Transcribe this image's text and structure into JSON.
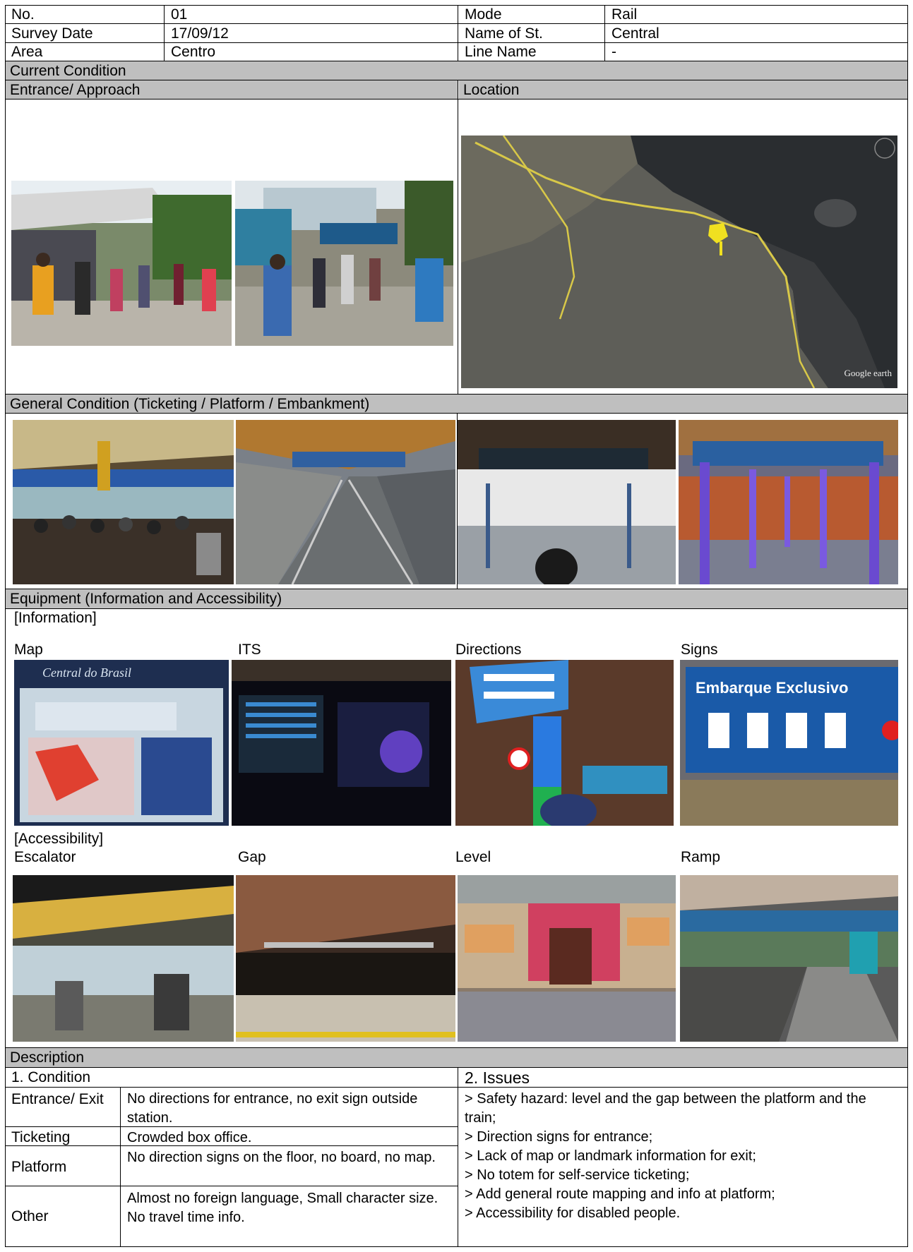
{
  "header": {
    "no_label": "No.",
    "no_value": "01",
    "mode_label": "Mode",
    "mode_value": "Rail",
    "date_label": "Survey Date",
    "date_value": "17/09/12",
    "station_label": "Name of St.",
    "station_value": "Central",
    "area_label": "Area",
    "area_value": "Centro",
    "line_label": "Line Name",
    "line_value": "-"
  },
  "sections": {
    "current_condition": "Current Condition",
    "entrance_approach": "Entrance/ Approach",
    "location": "Location",
    "general_condition": "General Condition (Ticketing / Platform / Embankment)",
    "equipment": "Equipment (Information  and  Accessibility)",
    "information": "[Information]",
    "accessibility": "[Accessibility]",
    "description": "Description"
  },
  "map_watermark": "Google earth",
  "information_items": [
    "Map",
    "ITS",
    "Directions",
    "Signs"
  ],
  "map_photo_text": "Central do Brasil",
  "sign_photo_text": "Embarque Exclusivo",
  "accessibility_items": [
    "Escalator",
    "Gap",
    "Level",
    "Ramp"
  ],
  "condition": {
    "title": "1.   Condition",
    "rows": [
      {
        "label": "Entrance/ Exit",
        "text": "No directions for entrance, no exit sign outside station."
      },
      {
        "label": "Ticketing",
        "text": "Crowded  box office."
      },
      {
        "label": "Platform",
        "text": "No direction signs on the floor, no board,  no map."
      },
      {
        "label": "Other",
        "text": "Almost no foreign language, Small character size. No travel time info."
      }
    ]
  },
  "issues": {
    "title": "2.   Issues",
    "items": [
      "> Safety hazard:   level and the gap between the platform and the train;",
      "> Direction signs for entrance;",
      "> Lack of map or landmark information for exit;",
      "> No totem for self-service ticketing;",
      "> Add general route mapping and info at platform;",
      "> Accessibility for disabled people."
    ]
  }
}
